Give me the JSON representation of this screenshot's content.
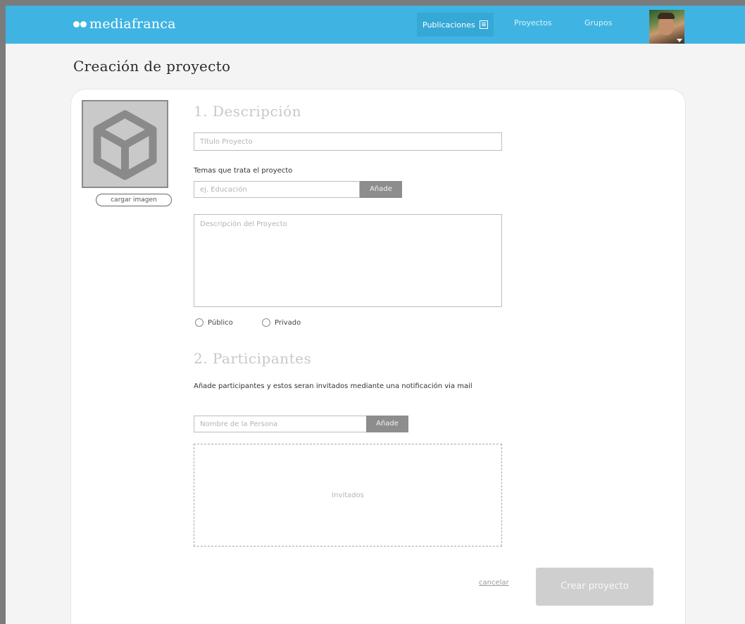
{
  "brand": {
    "name": "mediafranca"
  },
  "nav": {
    "items": [
      {
        "label": "Publicaciones"
      },
      {
        "label": "Proyectos"
      },
      {
        "label": "Grupos"
      }
    ]
  },
  "page": {
    "title": "Creación de proyecto"
  },
  "image": {
    "upload_label": "cargar imagen"
  },
  "section1": {
    "title": "1. Descripción",
    "title_placeholder": "Título Proyecto",
    "topics_label": "Temas que trata el proyecto",
    "topic_placeholder": "ej. Educación",
    "add_label": "Añade",
    "description_placeholder": "Descripción del Proyecto",
    "visibility": [
      {
        "label": "Público"
      },
      {
        "label": "Privado"
      }
    ]
  },
  "section2": {
    "title": "2. Participantes",
    "intro": "Añade participantes y estos seran invitados mediante una notificación via mail",
    "person_placeholder": "Nombre de la Persona",
    "add_label": "Añade",
    "invited_placeholder": "Invitados"
  },
  "actions": {
    "cancel_label": "cancelar",
    "create_label": "Crear proyecto"
  },
  "colors": {
    "topbar": "#3fb4e2",
    "button_gray": "#8d8d8d",
    "create_disabled": "#cfcfcf"
  }
}
